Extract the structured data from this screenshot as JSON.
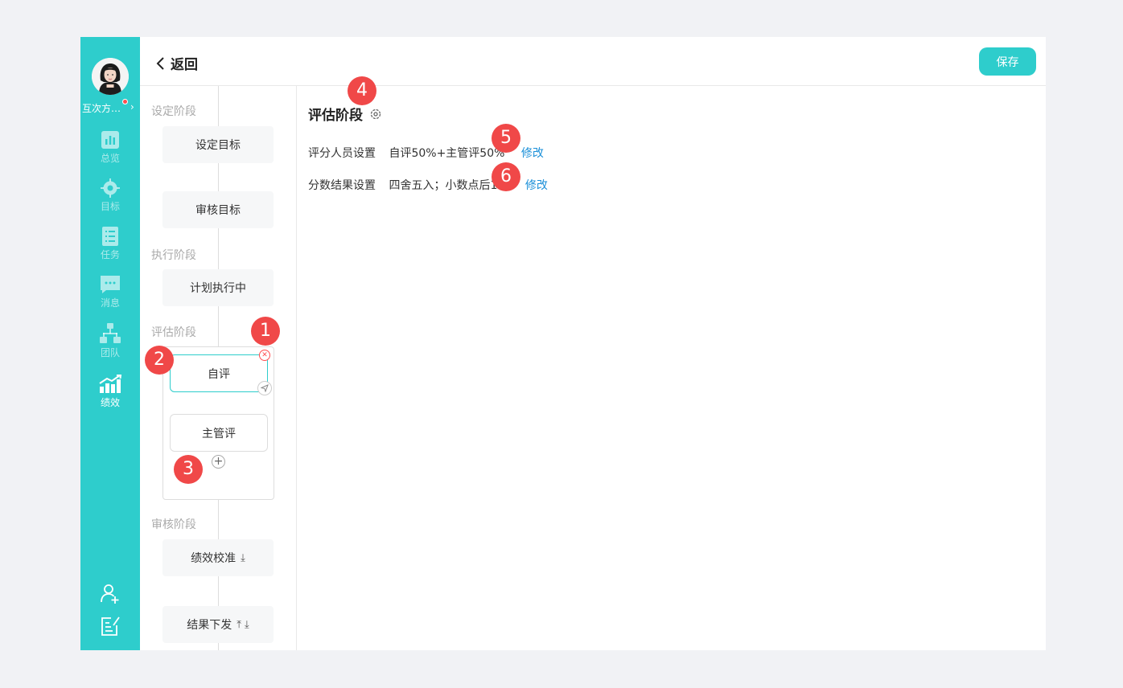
{
  "sidebar": {
    "org_name": "互次方…",
    "items": [
      {
        "label": "总览",
        "icon": "chart-icon"
      },
      {
        "label": "目标",
        "icon": "target-icon"
      },
      {
        "label": "任务",
        "icon": "task-list-icon"
      },
      {
        "label": "消息",
        "icon": "message-icon"
      },
      {
        "label": "团队",
        "icon": "team-icon"
      },
      {
        "label": "绩效",
        "icon": "performance-icon"
      }
    ],
    "active": "绩效",
    "bottom_icons": [
      "add-user-icon",
      "edit-note-icon"
    ]
  },
  "header": {
    "back_label": "返回",
    "save_label": "保存"
  },
  "flow": {
    "phases": {
      "setting": "设定阶段",
      "execution": "执行阶段",
      "evaluation": "评估阶段",
      "review": "审核阶段"
    },
    "nodes": {
      "set_goal": "设定目标",
      "review_goal": "审核目标",
      "plan_exec": "计划执行中",
      "self_eval": "自评",
      "manager_eval": "主管评",
      "calibration": "绩效校准",
      "result_issue": "结果下发"
    }
  },
  "main": {
    "title": "评估阶段",
    "settings": [
      {
        "label": "评分人员设置",
        "value": "自评50%+主管评50%",
        "action": "修改"
      },
      {
        "label": "分数结果设置",
        "value": "四舍五入；小数点后1位",
        "action": "修改"
      }
    ]
  },
  "badges": [
    "1",
    "2",
    "3",
    "4",
    "5",
    "6"
  ],
  "colors": {
    "accent": "#2ecdcc",
    "link": "#1a8fd8",
    "badge": "#f04848",
    "danger": "#ff4d4f"
  }
}
